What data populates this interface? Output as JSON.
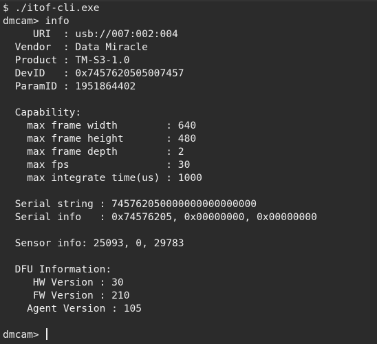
{
  "terminal": {
    "lines": [
      "$ ./itof-cli.exe",
      "dmcam> info",
      "     URI  : usb://007:002:004",
      "  Vendor  : Data Miracle",
      "  Product : TM-S3-1.0",
      "  DevID   : 0x7457620505007457",
      "  ParamID : 1951864402",
      "",
      "  Capability:",
      "    max frame width        : 640",
      "    max frame height       : 480",
      "    max frame depth        : 2",
      "    max fps                : 30",
      "    max integrate time(us) : 1000",
      "",
      "  Serial string : 745762050000000000000000",
      "  Serial info   : 0x74576205, 0x00000000, 0x00000000",
      "",
      "  Sensor info: 25093, 0, 29783",
      "",
      "  DFU Information:",
      "     HW Version : 30",
      "     FW Version : 210",
      "    Agent Version : 105"
    ],
    "prompt": "dmcam> "
  },
  "colors": {
    "background": "#2b2b2b",
    "foreground": "#eeeeee"
  }
}
